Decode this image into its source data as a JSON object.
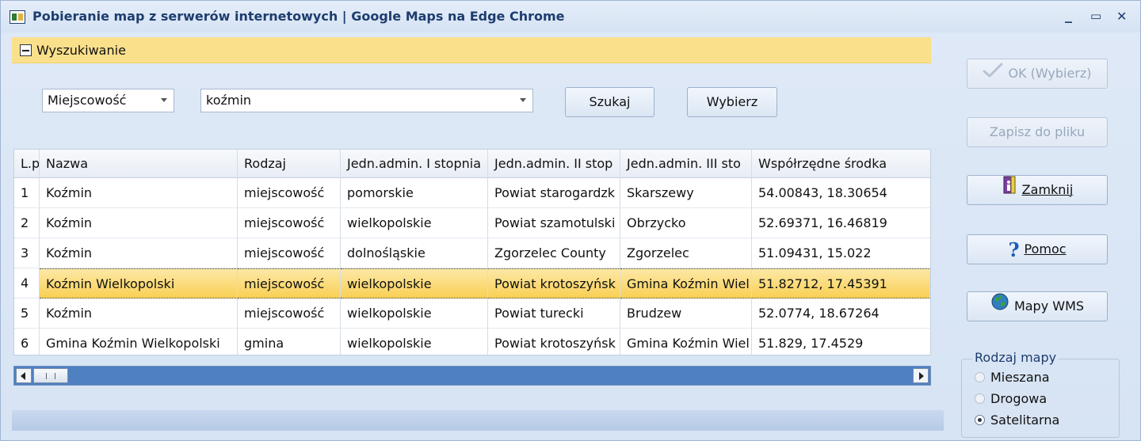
{
  "window": {
    "title": "Pobieranie map z serwerów internetowych  | Google Maps na Edge Chrome",
    "controls": {
      "minimize": "_",
      "maximize": "▭",
      "close": "✕"
    }
  },
  "search": {
    "header": "Wyszukiwanie",
    "type_select": "Miejscowość",
    "query": "koźmin",
    "search_button": "Szukaj",
    "choose_button": "Wybierz"
  },
  "table": {
    "columns": [
      "L.p",
      "Nazwa",
      "Rodzaj",
      "Jedn.admin. I stopnia",
      "Jedn.admin. II stop",
      "Jedn.admin. III sto",
      "Współrzędne środka"
    ],
    "rows": [
      [
        "1",
        "Koźmin",
        "miejscowość",
        "pomorskie",
        "Powiat starogardzk",
        "Skarszewy",
        "54.00843, 18.30654"
      ],
      [
        "2",
        "Koźmin",
        "miejscowość",
        "wielkopolskie",
        "Powiat szamotulski",
        "Obrzycko",
        "52.69371, 16.46819"
      ],
      [
        "3",
        "Koźmin",
        "miejscowość",
        "dolnośląskie",
        "Zgorzelec County",
        "Zgorzelec",
        "51.09431, 15.022"
      ],
      [
        "4",
        "Koźmin Wielkopolski",
        "miejscowość",
        "wielkopolskie",
        "Powiat krotoszyńsk",
        "Gmina Koźmin Wiel",
        "51.82712, 17.45391"
      ],
      [
        "5",
        "Koźmin",
        "miejscowość",
        "wielkopolskie",
        "Powiat turecki",
        "Brudzew",
        "52.0774, 18.67264"
      ],
      [
        "6",
        "Gmina Koźmin Wielkopolski",
        "gmina",
        "wielkopolskie",
        "Powiat krotoszyńsk",
        "Gmina Koźmin Wiel",
        "51.829, 17.4529"
      ]
    ],
    "selected_row": 4
  },
  "side": {
    "ok_button": "OK (Wybierz)",
    "save_button": "Zapisz do pliku",
    "close_button": "Zamknij",
    "help_button": "Pomoc",
    "wms_button": "Mapy WMS",
    "map_type": {
      "title": "Rodzaj mapy",
      "options": [
        "Mieszana",
        "Drogowa",
        "Satelitarna"
      ],
      "selected": "Satelitarna"
    }
  },
  "icons": {
    "ok": "checkmark-icon",
    "close": "exit-door-icon",
    "help": "question-mark-icon",
    "wms": "globe-icon"
  }
}
